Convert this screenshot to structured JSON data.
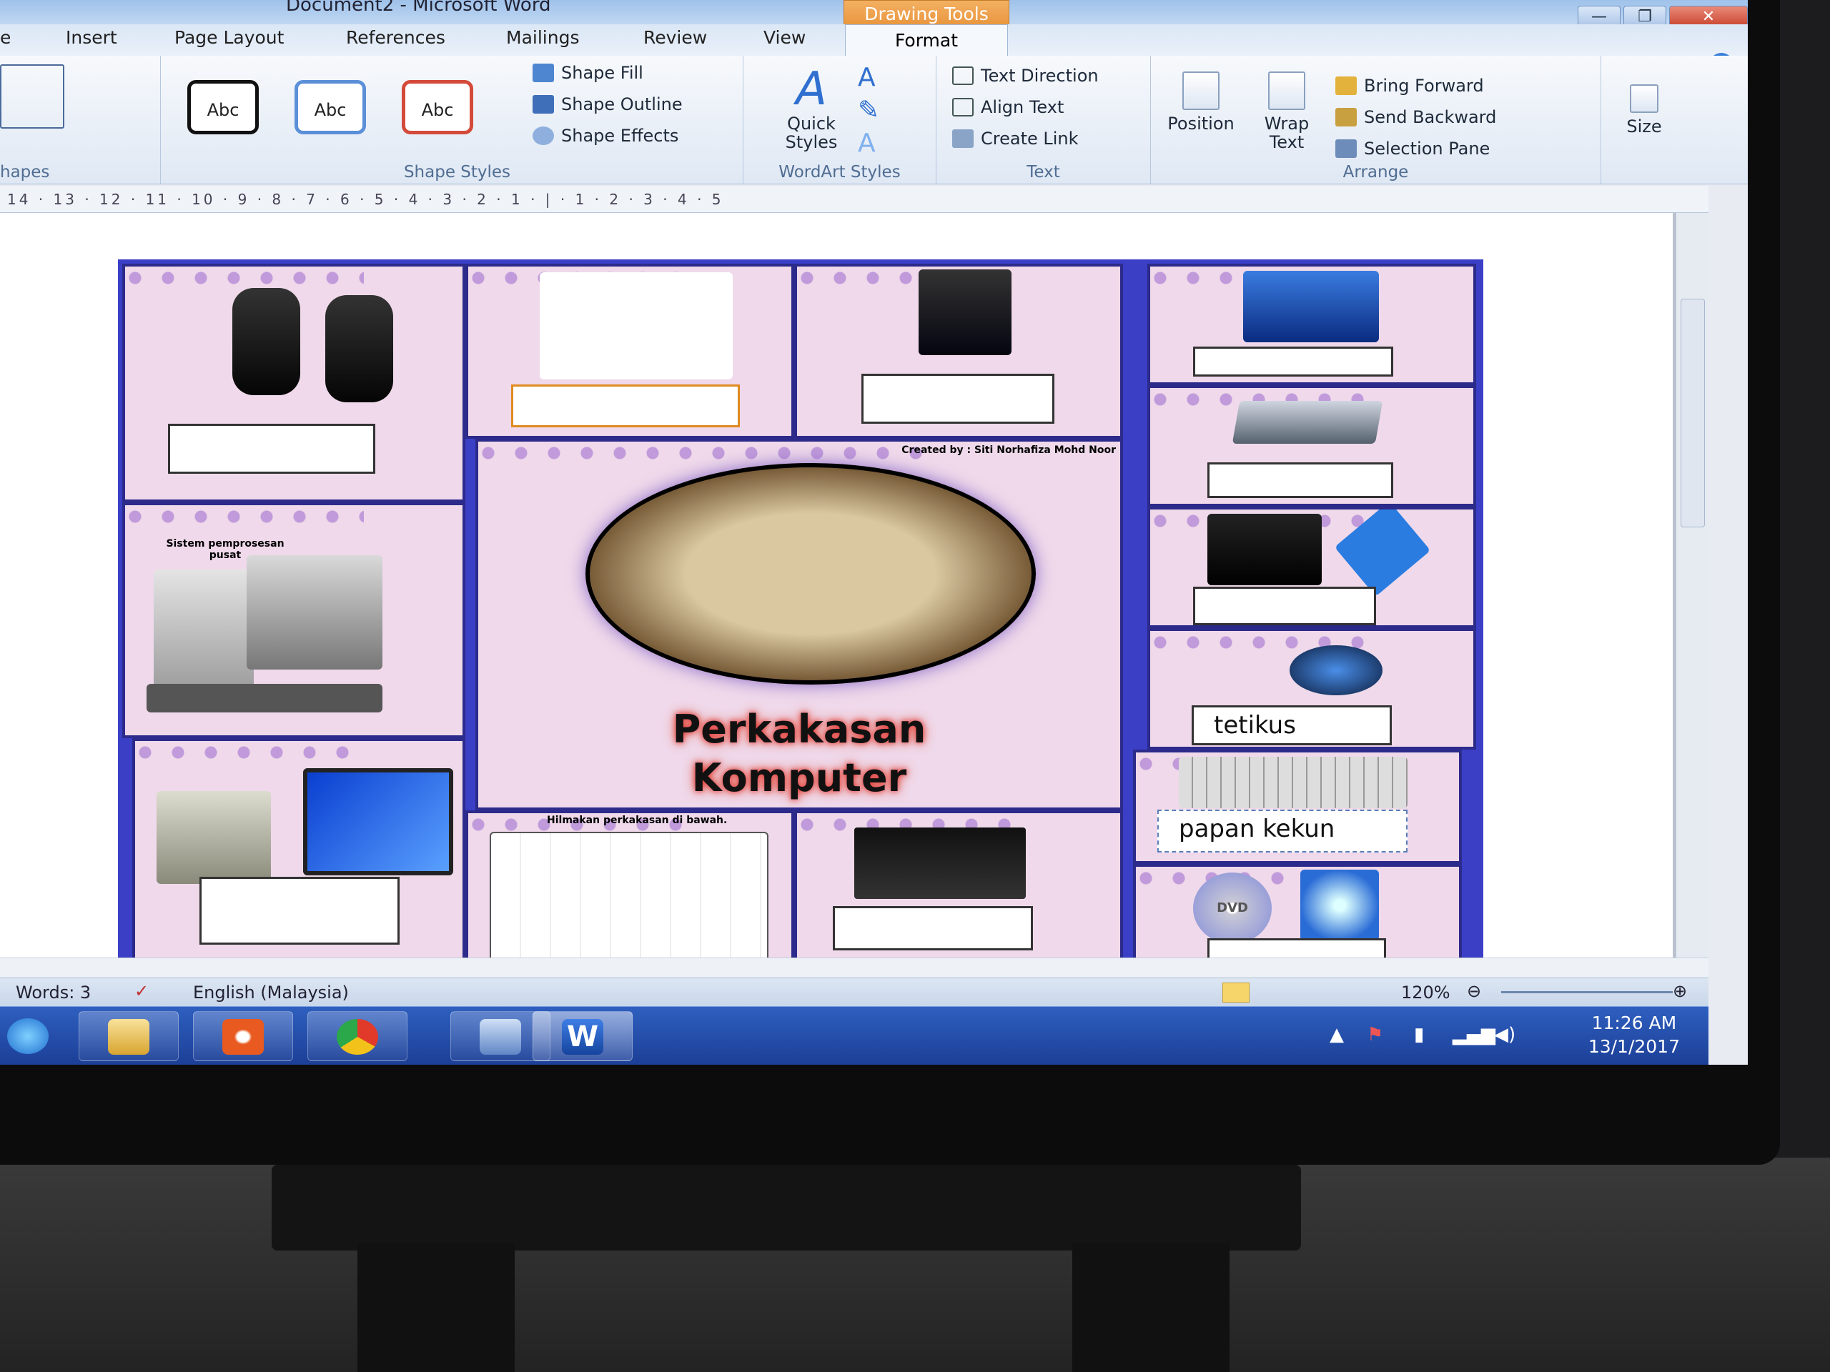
{
  "window": {
    "title": "Document2 - Microsoft Word",
    "context_tab": "Drawing Tools",
    "buttons": {
      "minimize": "—",
      "restore": "❐",
      "close": "✕"
    }
  },
  "tabs": [
    "e",
    "Insert",
    "Page Layout",
    "References",
    "Mailings",
    "Review",
    "View"
  ],
  "active_tab": "Format",
  "ribbon": {
    "shapes_label": "hapes",
    "shape_styles": {
      "samples": [
        "Abc",
        "Abc",
        "Abc"
      ],
      "fill": "Shape Fill",
      "outline": "Shape Outline",
      "effects": "Shape Effects",
      "label": "Shape Styles"
    },
    "wordart": {
      "quick_styles": "Quick Styles",
      "label": "WordArt Styles"
    },
    "text": {
      "direction": "Text Direction",
      "align": "Align Text",
      "link": "Create Link",
      "label": "Text"
    },
    "arrange": {
      "position": "Position",
      "wrap": "Wrap Text",
      "forward": "Bring Forward",
      "backward": "Send Backward",
      "pane": "Selection Pane",
      "label": "Arrange"
    },
    "size": {
      "label": "Size"
    }
  },
  "ruler": "14 · 13 · 12 · 11 · 10 · 9 · 8 · 7 · 6 · 5 · 4 · 3 · 2 · 1 · | · 1 · 2 · 3 · 4 · 5",
  "worksheet": {
    "credit": "Created by : Siti Norhafiza Mohd Noor",
    "title_line1": "Perkakasan",
    "title_line2": "Komputer",
    "cpu_caption": "Sistem pemprosesan pusat",
    "diagram_caption": "Hilmakan perkakasan di bawah.",
    "mouse_label": "tetikus",
    "keyboard_label": "papan kekun",
    "dvd_text": "DVD"
  },
  "status": {
    "words": "Words: 3",
    "language": "English (Malaysia)",
    "zoom": "120%"
  },
  "clock": {
    "time": "11:26 AM",
    "date": "13/1/2017"
  },
  "colors": {
    "sheet_border": "#3a3fc6",
    "cell_bg": "#efd9ea",
    "taskbar": "#1c3f97",
    "title_glow": "#e23a3a"
  }
}
